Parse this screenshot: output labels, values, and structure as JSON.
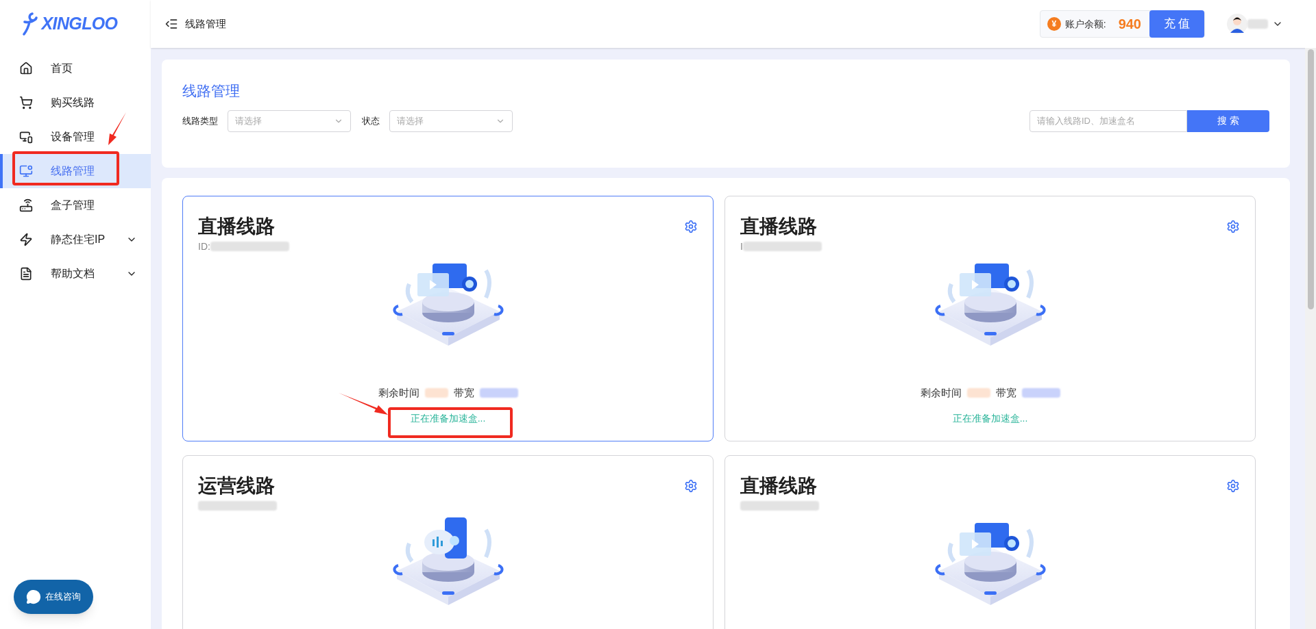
{
  "logo": {
    "text": "XINGLOO"
  },
  "sidebar": {
    "items": [
      {
        "label": "首页",
        "selected": false,
        "expandable": false
      },
      {
        "label": "购买线路",
        "selected": false,
        "expandable": false
      },
      {
        "label": "设备管理",
        "selected": false,
        "expandable": false
      },
      {
        "label": "线路管理",
        "selected": true,
        "expandable": false
      },
      {
        "label": "盒子管理",
        "selected": false,
        "expandable": false
      },
      {
        "label": "静态住宅IP",
        "selected": false,
        "expandable": true
      },
      {
        "label": "帮助文档",
        "selected": false,
        "expandable": true
      }
    ]
  },
  "header": {
    "breadcrumb": "线路管理",
    "currency_symbol": "¥",
    "balance_label": "账户余额:",
    "balance": "940",
    "recharge_button": "充 值"
  },
  "filter_panel": {
    "title": "线路管理",
    "filters": [
      {
        "label": "线路类型",
        "placeholder": "请选择"
      },
      {
        "label": "状态",
        "placeholder": "请选择"
      }
    ],
    "search": {
      "placeholder": "请输入线路ID、加速盒名",
      "button": "搜 索"
    }
  },
  "cards": [
    {
      "title": "直播线路",
      "id_label": "ID:",
      "kind": "camera",
      "selected": true,
      "remaining_label": "剩余时间",
      "bandwidth_label": "带宽",
      "status": "正在准备加速盒..."
    },
    {
      "title": "直播线路",
      "id_label": "I",
      "kind": "camera",
      "selected": false,
      "remaining_label": "剩余时间",
      "bandwidth_label": "带宽",
      "status": "正在准备加速盒..."
    },
    {
      "title": "运营线路",
      "kind": "phone",
      "selected": false
    },
    {
      "title": "直播线路",
      "kind": "camera",
      "selected": false
    }
  ],
  "chat_button": {
    "label": "在线咨询"
  }
}
